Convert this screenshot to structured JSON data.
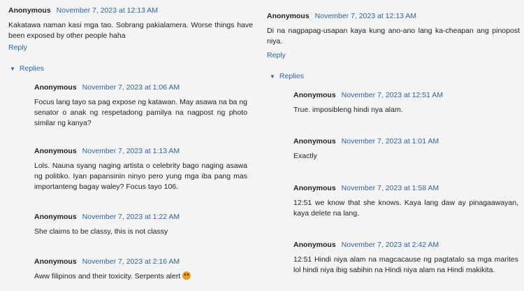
{
  "left": {
    "top": {
      "author": "Anonymous",
      "date": "November 7, 2023 at 12:13 AM",
      "text": "Kakatawa naman kasi mga tao. Sobrang pakialamera. Worse things have been exposed by other people haha"
    },
    "reply_label": "Reply",
    "replies_label": "Replies",
    "replies": [
      {
        "author": "Anonymous",
        "date": "November 7, 2023 at 1:06 AM",
        "text": "Focus lang tayo sa pag expose ng katawan. May asawa na ba ng senator o anak ng respetadong pamilya na nagpost ng photo similar ng kanya?"
      },
      {
        "author": "Anonymous",
        "date": "November 7, 2023 at 1:13 AM",
        "text": "Lols. Nauna syang naging artista o celebrity bago naging asawa ng politiko. Iyan papansinin ninyo pero yung mga iba pang mas importanteng bagay waley? Focus tayo 106."
      },
      {
        "author": "Anonymous",
        "date": "November 7, 2023 at 1:22 AM",
        "text": "She claims to be classy, this is not classy"
      },
      {
        "author": "Anonymous",
        "date": "November 7, 2023 at 2:16 AM",
        "text": "Aww filipinos and their toxicity. Serpents alert"
      }
    ]
  },
  "right": {
    "top": {
      "author": "Anonymous",
      "date": "November 7, 2023 at 12:13 AM",
      "text": "Di na nagpapag-usapan kaya kung ano-ano lang ka-cheapan ang pinopost niya."
    },
    "reply_label": "Reply",
    "replies_label": "Replies",
    "replies": [
      {
        "author": "Anonymous",
        "date": "November 7, 2023 at 12:51 AM",
        "text": "True. imposibleng hindi nya alam."
      },
      {
        "author": "Anonymous",
        "date": "November 7, 2023 at 1:01 AM",
        "text": "Exactly"
      },
      {
        "author": "Anonymous",
        "date": "November 7, 2023 at 1:58 AM",
        "text": "12:51 we know that she knows. Kaya lang daw ay pinagaawayan, kaya delete na lang."
      },
      {
        "author": "Anonymous",
        "date": "November 7, 2023 at 2:42 AM",
        "text": "12:51 Hindi niya alam na magcacause ng pagtatalo sa mga marites lol hindi niya ibig sabihin na Hindi niya alam na Hindi makikita."
      }
    ]
  },
  "colors": {
    "link": "#2b64a6",
    "background": "#f4f4f4"
  }
}
